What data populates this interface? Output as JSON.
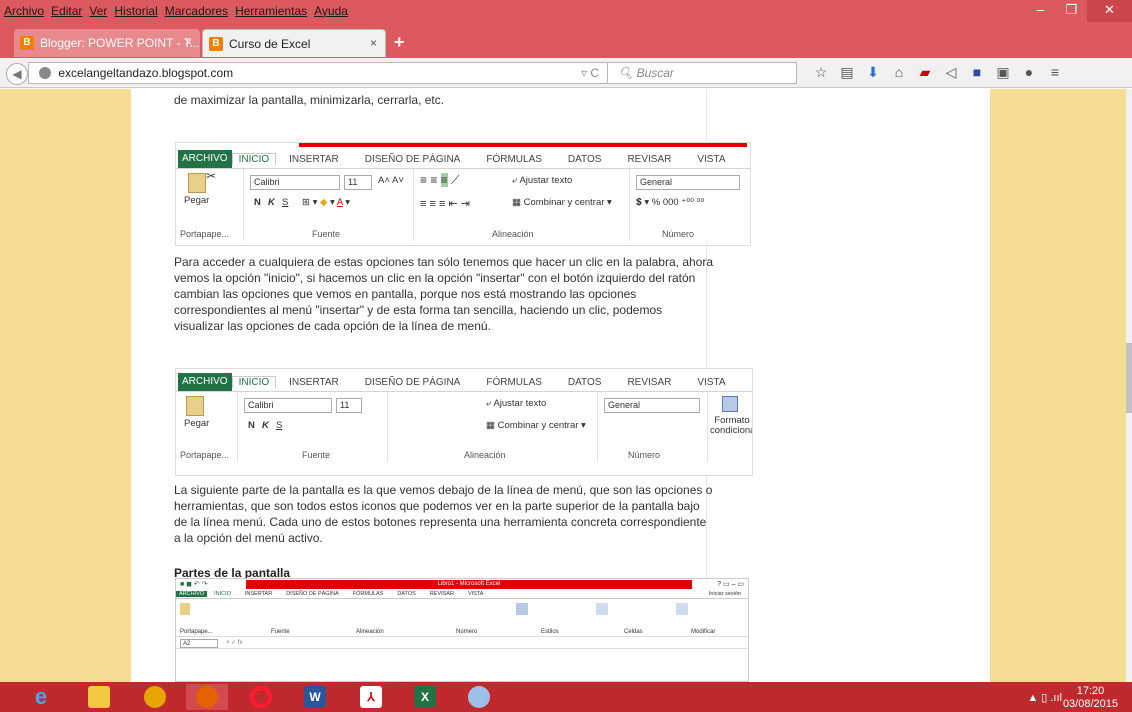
{
  "menubar": {
    "items": [
      "Archivo",
      "Editar",
      "Ver",
      "Historial",
      "Marcadores",
      "Herramientas",
      "Ayuda"
    ]
  },
  "window_controls": {
    "minimize": "–",
    "maximize": "❐",
    "close": "✕"
  },
  "tabs": [
    {
      "label": "Blogger: POWER POINT - T...",
      "favicon": "B",
      "close": "×"
    },
    {
      "label": "Curso de Excel",
      "favicon": "B",
      "close": "×"
    }
  ],
  "new_tab": "+",
  "navbar": {
    "url": "excelangeltandazo.blogspot.com",
    "search_placeholder": "Buscar"
  },
  "colors": {
    "chrome": "#dc5a5f",
    "page_bg": "#f7dc95",
    "excel_green": "#217346",
    "taskbar": "#c02a2f"
  },
  "article": {
    "intro": "de maximizar la pantalla, minimizarla, cerrarla, etc.",
    "para1": "Para acceder a cualquiera de estas opciones tan sólo tenemos que hacer un clic en la palabra, ahora vemos la opción \"inicio\", si hacemos un clic en la opción \"insertar\" con el botón izquierdo del ratón cambian las opciones que vemos en pantalla, porque nos está mostrando las opciones correspondientes al menú \"insertar\" y de esta forma tan sencilla, haciendo un clic, podemos visualizar las opciones de cada opción de la línea de menú.",
    "para2": "La siguiente parte de la pantalla es la que vemos debajo de la línea de menú, que son las opciones o herramientas, que son todos estos iconos que podemos ver en la parte superior de la pantalla bajo de la línea menú. Cada uno de estos botones representa una herramienta concreta correspondiente a la opción del menú activo.",
    "heading": "Partes de la pantalla"
  },
  "ribbon": {
    "tabs": [
      "ARCHIVO",
      "INICIO",
      "INSERTAR",
      "DISEÑO DE PÁGINA",
      "FÓRMULAS",
      "DATOS",
      "REVISAR",
      "VISTA"
    ],
    "paste": "Pegar",
    "font_name": "Calibri",
    "font_size": "11",
    "bold": "N",
    "italic": "K",
    "underline": "S",
    "wrap_text": "Ajustar texto",
    "merge_center": "Combinar y centrar",
    "number_format": "General",
    "percent": "%",
    "thousands": "000",
    "conditional": "Formato condicional",
    "groups": [
      "Portapape...",
      "Fuente",
      "Alineación",
      "Número"
    ]
  },
  "mini_excel": {
    "title": "Libro1 - Microsoft Excel",
    "signin": "Iniciar sesión",
    "tabs": [
      "ARCHIVO",
      "INICIO",
      "INSERTAR",
      "DISEÑO DE PÁGINA",
      "FÓRMULAS",
      "DATOS",
      "REVISAR",
      "VISTA"
    ],
    "groups": [
      "Portapape...",
      "Fuente",
      "Alineación",
      "Número",
      "Estilos",
      "Celdas",
      "Modificar"
    ],
    "cell": "A2"
  },
  "taskbar": {
    "apps": [
      "ie",
      "explorer",
      "chrome",
      "firefox",
      "opera",
      "word",
      "acrobat",
      "excel",
      "paint"
    ],
    "time": "17:20",
    "date": "03/08/2015"
  }
}
